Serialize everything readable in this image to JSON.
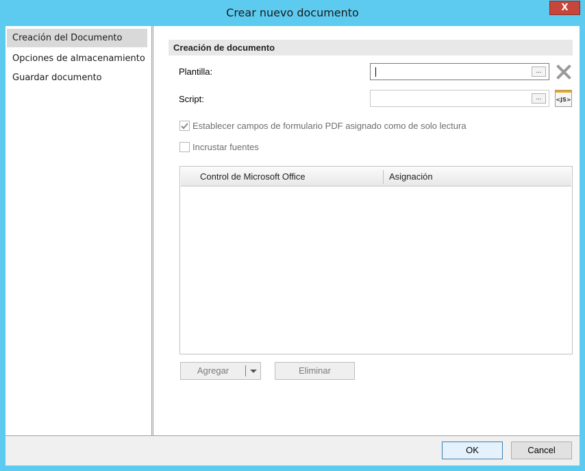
{
  "window": {
    "title": "Crear nuevo documento",
    "close_label": "X"
  },
  "nav": {
    "items": [
      {
        "label": "Creación del Documento",
        "selected": true
      },
      {
        "label": "Opciones de almacenamiento",
        "selected": false
      },
      {
        "label": "Guardar documento",
        "selected": false
      }
    ]
  },
  "section": {
    "header": "Creación de documento"
  },
  "form": {
    "template": {
      "label": "Plantilla:",
      "value": "",
      "browse_label": "..."
    },
    "script": {
      "label": "Script:",
      "value": "",
      "browse_label": "...",
      "js_label": "<JS>"
    },
    "readonly_checkbox": {
      "label": "Establecer campos de formulario PDF asignado como de solo lectura",
      "checked": true,
      "enabled": false
    },
    "embed_fonts_checkbox": {
      "label": "Incrustar fuentes",
      "checked": false,
      "enabled": false
    }
  },
  "grid": {
    "columns": [
      "Control de Microsoft Office",
      "Asignación"
    ],
    "rows": []
  },
  "grid_buttons": {
    "add": "Agregar",
    "remove": "Eliminar"
  },
  "footer": {
    "ok": "OK",
    "cancel": "Cancel"
  },
  "colors": {
    "titlebar": "#5ccbef",
    "close": "#c7463b",
    "accent_js": "#f0a500"
  }
}
